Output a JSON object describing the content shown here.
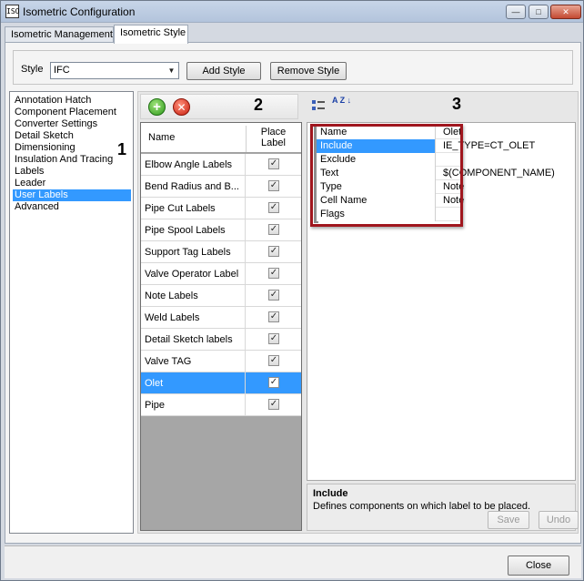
{
  "window": {
    "title": "Isometric Configuration",
    "app_icon_text": "ISO",
    "controls": {
      "minimize": "—",
      "maximize": "□",
      "close": "✕"
    }
  },
  "tabs": [
    {
      "label": "Isometric Management",
      "active": false
    },
    {
      "label": "Isometric Style",
      "active": true
    }
  ],
  "style_row": {
    "label": "Style",
    "selected": "IFC",
    "add_style": "Add Style",
    "remove_style": "Remove Style"
  },
  "tree": {
    "items": [
      "Annotation Hatch",
      "Component Placement",
      "Converter Settings",
      "Detail Sketch",
      "Dimensioning",
      "Insulation And Tracing",
      "Labels",
      "Leader",
      "User Labels",
      "Advanced"
    ],
    "selected": "User Labels"
  },
  "markers": {
    "one": "1",
    "two": "2",
    "three": "3"
  },
  "labels_grid": {
    "header_name": "Name",
    "header_place_line1": "Place",
    "header_place_line2": "Label",
    "rows": [
      {
        "name": "Elbow Angle Labels",
        "checked": "✓"
      },
      {
        "name": "Bend Radius and B...",
        "checked": "✓"
      },
      {
        "name": "Pipe Cut Labels",
        "checked": "✓"
      },
      {
        "name": "Pipe Spool Labels",
        "checked": "✓"
      },
      {
        "name": "Support Tag Labels",
        "checked": "✓"
      },
      {
        "name": "Valve Operator Label",
        "checked": "✓"
      },
      {
        "name": "Note Labels",
        "checked": "✓"
      },
      {
        "name": "Weld Labels",
        "checked": "✓"
      },
      {
        "name": "Detail Sketch labels",
        "checked": "✓"
      },
      {
        "name": "Valve TAG",
        "checked": "✓"
      },
      {
        "name": "Olet",
        "checked": "✓"
      },
      {
        "name": "Pipe",
        "checked": "✓"
      }
    ],
    "selected": "Olet"
  },
  "properties": {
    "rows": [
      {
        "name": "Name",
        "value": "Olet"
      },
      {
        "name": "Include",
        "value": "IE_TYPE=CT_OLET"
      },
      {
        "name": "Exclude",
        "value": ""
      },
      {
        "name": "Text",
        "value": "$(COMPONENT_NAME)"
      },
      {
        "name": "Type",
        "value": "Note"
      },
      {
        "name": "Cell Name",
        "value": "Note"
      },
      {
        "name": "Flags",
        "value": ""
      }
    ],
    "selected": "Include",
    "sort_icon_text": "A Z"
  },
  "description": {
    "title": "Include",
    "text": "Defines components on which label to be placed."
  },
  "buttons": {
    "save": "Save",
    "undo": "Undo",
    "close": "Close"
  },
  "colors": {
    "selection": "#3399ff",
    "highlight_border": "#a0161e"
  }
}
